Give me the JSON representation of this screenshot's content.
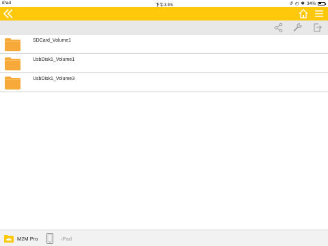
{
  "status_bar": {
    "device": "iPad",
    "time": "下午3:05",
    "battery": "34%",
    "battery_level": 0.34
  },
  "nav": {
    "back_icon": "double-chevron-left-icon",
    "home_icon": "home-icon",
    "menu_icon": "hamburger-menu-icon"
  },
  "toolbar": {
    "icons": [
      "share-icon",
      "wrench-icon",
      "export-icon"
    ]
  },
  "files": [
    {
      "name": "SDCard_Volume1",
      "icon": "folder-icon"
    },
    {
      "name": "UsbDisk1_Volume1",
      "icon": "folder-icon"
    },
    {
      "name": "UsbDisk1_Volume3",
      "icon": "folder-icon"
    }
  ],
  "bottom_tabs": [
    {
      "label": "M2M Pro",
      "icon": "cloud-folder-icon",
      "active": true
    },
    {
      "label": "iPad",
      "icon": "ipad-icon",
      "active": false
    }
  ],
  "colors": {
    "accent": "#ffc80a",
    "folder": "#f7a93a",
    "toolbar_bg": "#e8e8e8"
  }
}
